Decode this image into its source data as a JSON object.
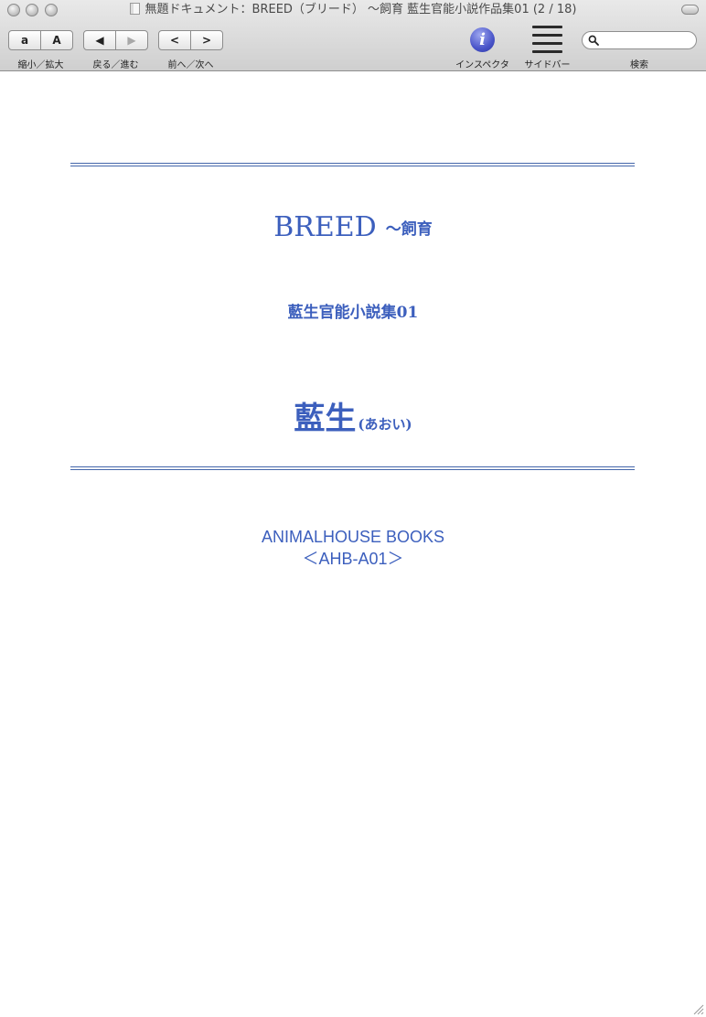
{
  "window": {
    "title": "無題ドキュメント：BREED（ブリード） 〜飼育 藍生官能小説作品集01 (2 / 18)"
  },
  "toolbar": {
    "zoom": {
      "small": "a",
      "large": "A",
      "label": "縮小／拡大"
    },
    "history": {
      "back": "◀",
      "forward": "▶",
      "label": "戻る／進む"
    },
    "page": {
      "prev": "<",
      "next": ">",
      "label": "前へ／次へ"
    },
    "inspector": {
      "icon": "info-icon",
      "glyph": "i",
      "label": "インスペクタ"
    },
    "sidebar": {
      "icon": "sidebar-icon",
      "label": "サイドバー"
    },
    "search": {
      "value": "",
      "placeholder": "",
      "label": "検索"
    }
  },
  "document": {
    "title": "BREED",
    "subtitle": "〜飼育",
    "series": "藍生官能小説集01",
    "author": "藍生",
    "author_reading": "(あおい)",
    "publisher": "ANIMALHOUSE BOOKS",
    "code": "＜AHB-A01＞"
  },
  "colors": {
    "accent": "#3c5fbd",
    "rule": "#4466aa"
  }
}
